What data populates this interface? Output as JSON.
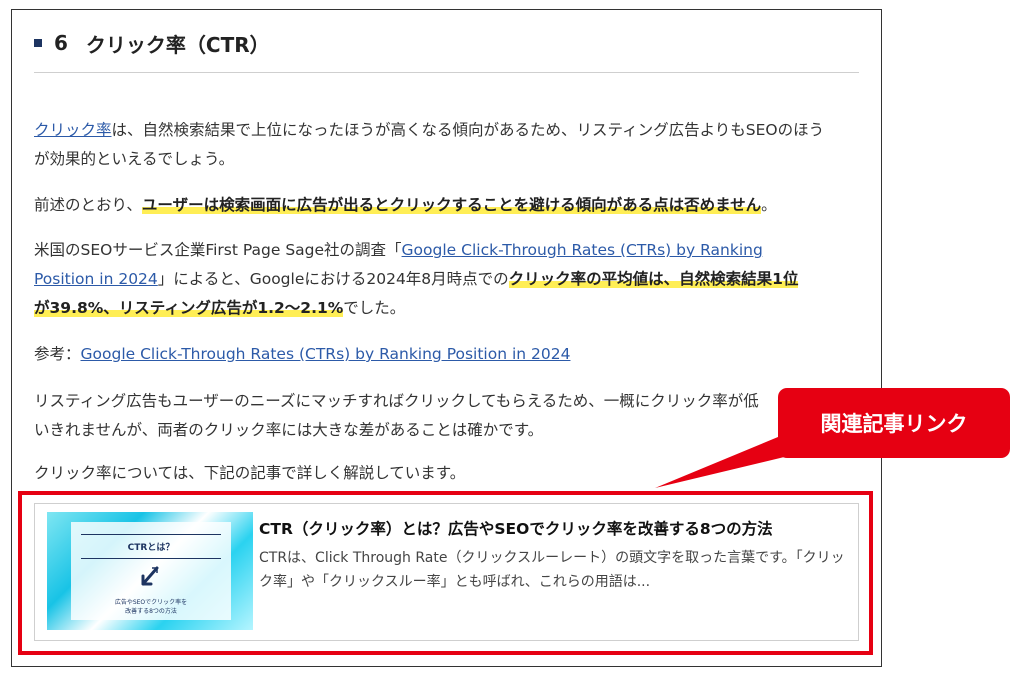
{
  "heading": {
    "number": "6",
    "title": "クリック率（CTR）"
  },
  "paragraphs": {
    "p1": {
      "link": "クリック率",
      "line1_rest": "は、自然検索結果で上位になったほうが高くなる傾向があるため、リスティング広告よりもSEOのほう",
      "line2": "が効果的といえるでしょう。"
    },
    "p2": {
      "pre": "前述のとおり、",
      "highlight": "ユーザーは検索画面に広告が出るとクリックすることを避ける傾向がある点は否めません",
      "post": "。"
    },
    "p3": {
      "pre": "米国のSEOサービス企業First Page Sage社の調査「",
      "link_line1": "Google Click-Through Rates (CTRs) by Ranking",
      "link_line2": "Position in 2024",
      "mid": "」によると、Googleにおける2024年8月時点での",
      "highlight_line2": "クリック率の平均値は、自然検索結果1位",
      "highlight_line3": "が39.8%、リスティング広告が1.2〜2.1%",
      "post": "でした。"
    },
    "p4": {
      "pre": "参考：",
      "link": "Google Click-Through Rates (CTRs) by Ranking Position in 2024"
    },
    "p5": {
      "line1": "リスティング広告もユーザーのニーズにマッチすればクリックしてもらえるため、一概にクリック率が低",
      "line2": "いきれませんが、両者のクリック率には大きな差があることは確かです。"
    },
    "p6": {
      "text": "クリック率については、下記の記事で詳しく解説しています。"
    }
  },
  "card": {
    "thumb_title": "CTRとは？",
    "thumb_sub1": "広告やSEOでクリック率を",
    "thumb_sub2": "改善する8つの方法",
    "title": "CTR（クリック率）とは？広告やSEOでクリック率を改善する8つの方法",
    "desc": "CTRは、Click Through Rate（クリックスルーレート）の頭文字を取った言葉です。「クリック率」や「クリックスルー率」とも呼ばれ、これらの用語は..."
  },
  "callout": {
    "label": "関連記事リンク"
  },
  "colors": {
    "accent_red": "#e60012",
    "link_blue": "#2c5aa8",
    "highlight_yellow": "#ffee55",
    "heading_square": "#1d3461"
  },
  "icons": {
    "heading_marker": "square-bullet-icon",
    "thumb_cursor": "cursor-arrow-icon"
  }
}
